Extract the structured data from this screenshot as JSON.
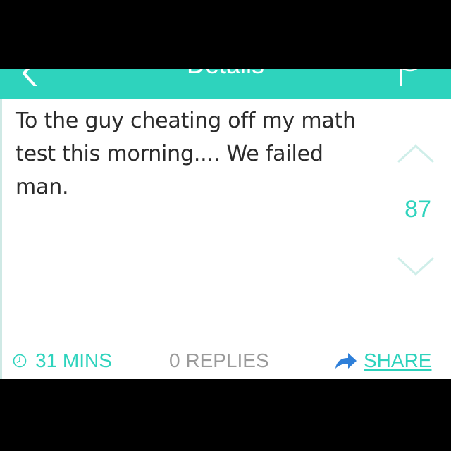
{
  "header": {
    "title": "Details"
  },
  "post": {
    "text": "To the guy cheating off my math test this morning.... We failed man.",
    "vote_count": "87"
  },
  "footer": {
    "time": "31 MINS",
    "replies": "0 REPLIES",
    "share": "SHARE"
  },
  "colors": {
    "accent": "#2ed3bd",
    "text": "#2b2b2b",
    "muted": "#9a9a9a",
    "chevron": "#cfeee9"
  },
  "icons": {
    "back": "chevron-left-icon",
    "flag": "flag-icon",
    "upvote": "chevron-up-icon",
    "downvote": "chevron-down-icon",
    "time": "clock-icon",
    "share": "share-arrow-icon"
  }
}
